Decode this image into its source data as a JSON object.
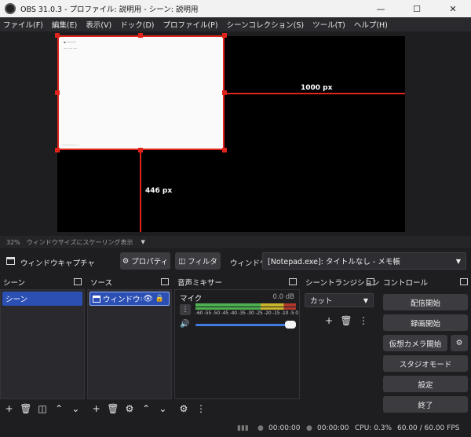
{
  "window": {
    "title": "OBS 31.0.3 - プロファイル: 説明用 - シーン: 説明用"
  },
  "menu": [
    "ファイル(F)",
    "編集(E)",
    "表示(V)",
    "ドック(D)",
    "プロファイル(P)",
    "シーンコレクション(S)",
    "ツール(T)",
    "ヘルプ(H)"
  ],
  "preview": {
    "width_label": "1000 px",
    "height_label": "446 px",
    "zoom": "32%",
    "scaling_mode": "ウィンドウサイズにスケーリング表示",
    "accent_color": "#e0241b"
  },
  "context": {
    "source_name": "ウィンドウキャプチャ",
    "properties_label": "プロパティ",
    "filters_label": "フィルタ",
    "window_label": "ウィンドウ",
    "window_value": "[Notepad.exe]: タイトルなし - メモ帳"
  },
  "scenes": {
    "header": "シーン",
    "items": [
      "シーン"
    ]
  },
  "sources": {
    "header": "ソース",
    "items": [
      "ウィンドウキャ"
    ]
  },
  "mixer": {
    "header": "音声ミキサー",
    "channel": "マイク",
    "level": "0.0 dB",
    "scale": "-60 -55 -50 -45 -40 -35 -30 -25 -20 -15 -10 -5 0"
  },
  "transitions": {
    "header": "シーントランジション",
    "selected": "カット"
  },
  "controls": {
    "header": "コントロール",
    "start_streaming": "配信開始",
    "start_recording": "録画開始",
    "start_virtual_cam": "仮想カメラ開始",
    "studio_mode": "スタジオモード",
    "settings": "設定",
    "exit": "終了"
  },
  "status": {
    "stream_time": "00:00:00",
    "record_time": "00:00:00",
    "cpu": "CPU: 0.3%",
    "fps": "60.00 / 60.00 FPS"
  }
}
